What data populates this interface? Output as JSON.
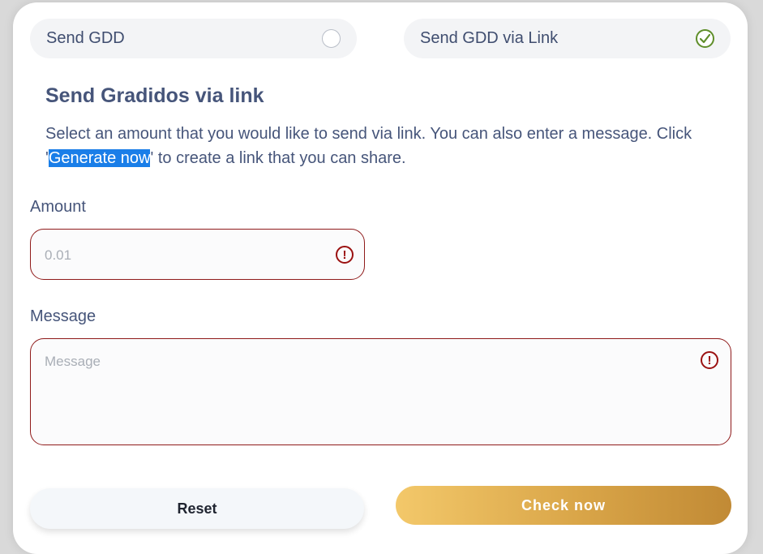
{
  "options": {
    "send_gdd": {
      "label": "Send GDD",
      "checked": false
    },
    "send_link": {
      "label": "Send GDD via Link",
      "checked": true
    }
  },
  "section": {
    "title": "Send Gradidos via link",
    "desc_before": "Select an amount that you would like to send via link. You can also enter a message. Click '",
    "desc_highlight": "Generate now",
    "desc_after": "' to create a link that you can share."
  },
  "amount": {
    "label": "Amount",
    "placeholder": "0.01",
    "value": ""
  },
  "message": {
    "label": "Message",
    "placeholder": "Message",
    "value": ""
  },
  "buttons": {
    "reset": "Reset",
    "check": "Check now"
  },
  "colors": {
    "accent_gold": "#d9a548",
    "error": "#9b1111",
    "check_green": "#5f8e2a"
  }
}
